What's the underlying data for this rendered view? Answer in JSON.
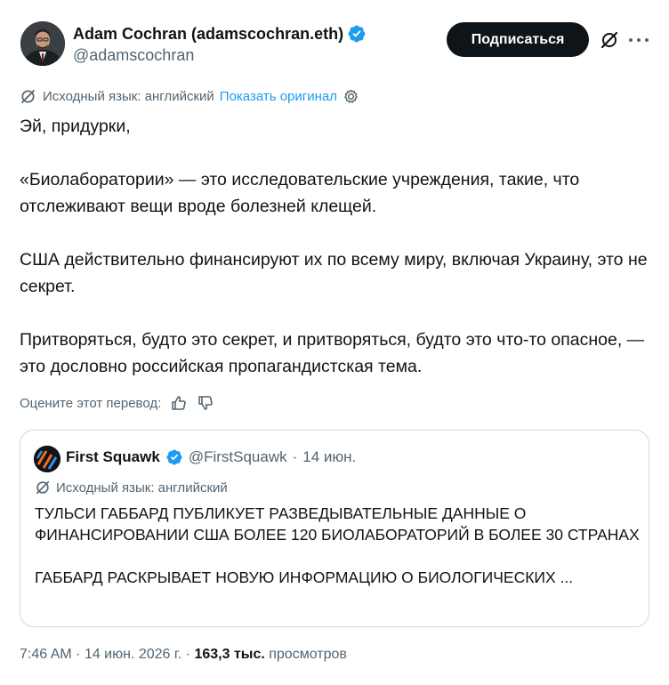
{
  "author": {
    "name": "Adam Cochran (adamscochran.eth)",
    "handle": "@adamscochran",
    "verified": true
  },
  "actions": {
    "follow_label": "Подписаться",
    "grok_icon": "grok-slash-icon",
    "more_icon": "more-dots-icon"
  },
  "translation": {
    "source_text": "Исходный язык: английский",
    "show_original_label": "Показать оригинал",
    "settings_icon": "gear-icon"
  },
  "tweet": {
    "paragraphs": [
      "Эй, придурки,",
      "«Биолаборатории» — это исследовательские учреждения, такие, что отслеживают вещи вроде болезней клещей.",
      "США действительно финансируют их по всему миру, включая Украину, это не секрет.",
      "Притворяться, будто это секрет, и притворяться, будто это что-то опасное, — это дословно российская пропагандистская тема."
    ]
  },
  "rating": {
    "label": "Оцените этот перевод:",
    "like_icon": "thumbs-up-icon",
    "dislike_icon": "thumbs-down-icon"
  },
  "quote": {
    "name": "First Squawk",
    "handle": "@FirstSquawk",
    "separator": "·",
    "date": "14 июн.",
    "source_text": "Исходный язык: английский",
    "paragraphs": [
      "ТУЛЬСИ ГАББАРД ПУБЛИКУЕТ РАЗВЕДЫВАТЕЛЬНЫЕ ДАННЫЕ О ФИНАНСИРОВАНИИ США БОЛЕЕ 120 БИОЛАБОРАТОРИЙ В БОЛЕЕ 30 СТРАНАХ",
      "ГАББАРД РАСКРЫВАЕТ НОВУЮ ИНФОРМАЦИЮ О БИОЛОГИЧЕСКИХ ..."
    ]
  },
  "meta": {
    "time": "7:46 AM",
    "separator": "·",
    "date": "14 июн. 2026 г.",
    "views_count": "163,3 тыс.",
    "views_label": "просмотров"
  },
  "colors": {
    "text": "#0f1419",
    "secondary": "#536471",
    "link": "#1d9bf0",
    "verified": "#1d9bf0",
    "border": "#cfd9de"
  }
}
